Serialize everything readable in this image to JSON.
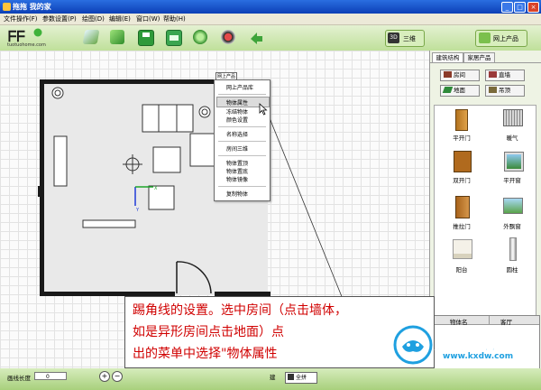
{
  "window": {
    "title": "拖拖 我的家"
  },
  "menubar": [
    {
      "label": "文件操作(F)"
    },
    {
      "label": "参数设置(P)"
    },
    {
      "label": "绘图(D)"
    },
    {
      "label": "编辑(E)"
    },
    {
      "label": "窗口(W)"
    },
    {
      "label": "帮助(H)"
    }
  ],
  "logo": {
    "domain": "tuotuohome.com"
  },
  "toolbar": {
    "view3d_icon": "3D",
    "view3d_label": "三维",
    "online_products_label": "网上产品"
  },
  "context_menu": {
    "tag_label": "网上产品",
    "items": [
      "网上产品库",
      "物体属性",
      "冻结物体",
      "颜色设置",
      "名称选择",
      "房间三维",
      "物体置顶",
      "物体置底",
      "物体镜像",
      "复制物体"
    ],
    "highlighted": "物体属性"
  },
  "right_panel": {
    "tabs": [
      "建筑结构",
      "家居产品"
    ],
    "active_tab": "建筑结构",
    "categories": [
      {
        "label": "房间",
        "icon": "room-icon"
      },
      {
        "label": "直墙",
        "icon": "wall-icon"
      },
      {
        "label": "地面",
        "icon": "floor-icon"
      },
      {
        "label": "吊顶",
        "icon": "ceiling-icon"
      }
    ],
    "items": [
      {
        "label": "平开门",
        "icon": "swing-door-icon"
      },
      {
        "label": "暖气",
        "icon": "radiator-icon"
      },
      {
        "label": "双开门",
        "icon": "double-door-icon"
      },
      {
        "label": "平开窗",
        "icon": "casement-window-icon"
      },
      {
        "label": "推拉门",
        "icon": "sliding-door-icon"
      },
      {
        "label": "外飘窗",
        "icon": "bay-window-icon"
      },
      {
        "label": "阳台",
        "icon": "balcony-icon"
      },
      {
        "label": "圆柱",
        "icon": "column-icon"
      }
    ],
    "properties": {
      "col_name": "物体名",
      "col_value": "客厅"
    }
  },
  "statusbar": {
    "wall_length_label": "画线长度",
    "wall_length_value": "0",
    "fit_label": "全拼",
    "layer_label": "建"
  },
  "annotation": {
    "line1": "踢角线的设置。选中房间（点击墙体，",
    "line2": "如是异形房间点击地面）点",
    "line3": "出的菜单中选择\"物体属性"
  },
  "watermark": {
    "brand": "开心电玩",
    "domain": "www.kxdw.com"
  },
  "colors": {
    "title_blue": "#1a55cf",
    "toolbar_green": "#bfe09a",
    "annotation_red": "#d00000",
    "watermark_blue": "#1fa0e0"
  }
}
